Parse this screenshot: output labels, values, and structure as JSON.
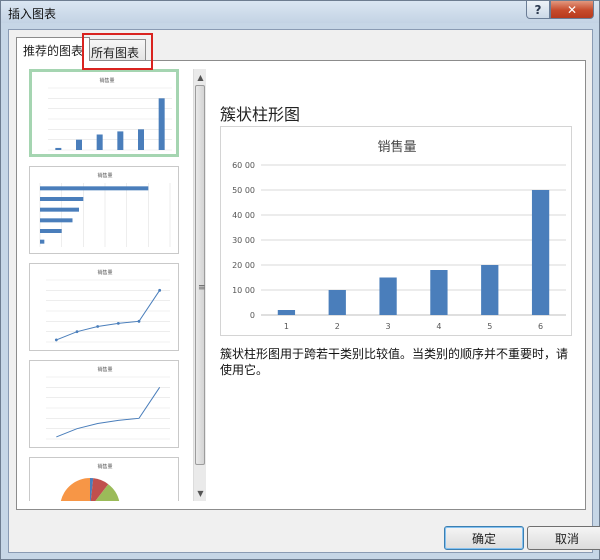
{
  "window": {
    "title": "插入图表",
    "help_label": "?",
    "close_label": "✕"
  },
  "tabs": [
    {
      "label": "推荐的图表",
      "active": true
    },
    {
      "label": "所有图表",
      "active": false,
      "highlighted": true
    }
  ],
  "thumbnails": [
    {
      "title": "销售量",
      "kind": "column"
    },
    {
      "title": "销售量",
      "kind": "bar"
    },
    {
      "title": "销售量",
      "kind": "line-markers"
    },
    {
      "title": "销售量",
      "kind": "line"
    },
    {
      "title": "销售量",
      "kind": "pie"
    }
  ],
  "preview": {
    "heading": "簇状柱形图",
    "description": "簇状柱形图用于跨若干类别比较值。当类别的顺序并不重要时，请使用它。"
  },
  "chart_data": {
    "type": "bar",
    "title": "销售量",
    "categories": [
      "1",
      "2",
      "3",
      "4",
      "5",
      "6"
    ],
    "values": [
      200,
      1000,
      1500,
      1800,
      2000,
      5000
    ],
    "ylim": [
      0,
      6000
    ],
    "yticks": [
      0,
      1000,
      2000,
      3000,
      4000,
      5000,
      6000
    ],
    "ytick_labels": [
      "0",
      "10 00",
      "20 00",
      "30 00",
      "40 00",
      "50 00",
      "60 00"
    ],
    "grid": true,
    "bar_color": "#4a7ebb"
  },
  "buttons": {
    "ok": "确定",
    "cancel": "取消"
  },
  "colors": {
    "accent": "#4a7ebb",
    "selected_border": "#a5d5b1",
    "highlight": "#d9231f"
  }
}
